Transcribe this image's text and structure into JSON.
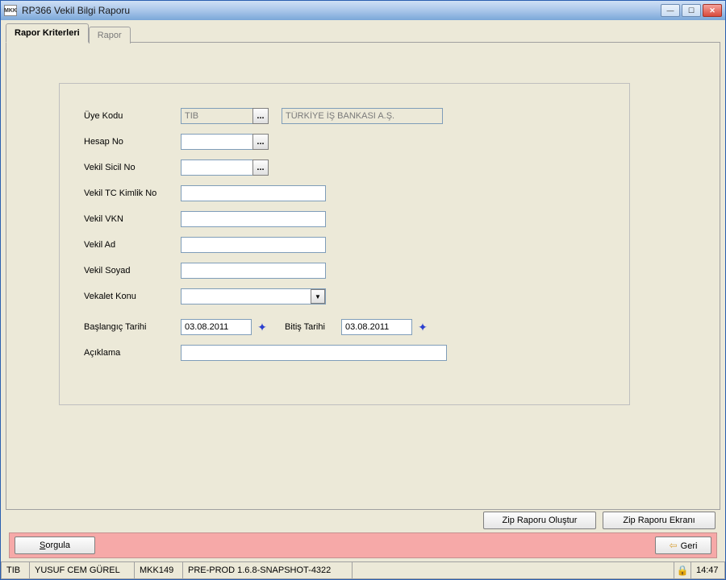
{
  "window": {
    "title": "RP366 Vekil Bilgi Raporu",
    "app_icon_text": "MKK"
  },
  "tabs": {
    "criteria": "Rapor Kriterleri",
    "report": "Rapor"
  },
  "labels": {
    "uye_kodu": "Üye Kodu",
    "hesap_no": "Hesap No",
    "vekil_sicil_no": "Vekil Sicil No",
    "vekil_tc": "Vekil TC Kimlik No",
    "vekil_vkn": "Vekil VKN",
    "vekil_ad": "Vekil Ad",
    "vekil_soyad": "Vekil Soyad",
    "vekalet_konu": "Vekalet Konu",
    "baslangic": "Başlangıç Tarihi",
    "bitis": "Bitiş Tarihi",
    "aciklama": "Açıklama"
  },
  "values": {
    "uye_kodu": "TIB",
    "uye_adi": "TÜRKİYE İŞ BANKASI A.Ş.",
    "hesap_no": "",
    "vekil_sicil_no": "",
    "vekil_tc": "",
    "vekil_vkn": "",
    "vekil_ad": "",
    "vekil_soyad": "",
    "vekalet_konu": "",
    "baslangic": "03.08.2011",
    "bitis": "03.08.2011",
    "aciklama": ""
  },
  "buttons": {
    "zip_create": "Zip Raporu Oluştur",
    "zip_screen": "Zip Raporu Ekranı",
    "sorgula": "Sorgula",
    "geri": "Geri"
  },
  "status": {
    "code": "TIB",
    "user": "YUSUF CEM GÜREL",
    "terminal": "MKK149",
    "version": "PRE-PROD 1.6.8-SNAPSHOT-4322",
    "clock": "14:47"
  },
  "icons": {
    "ellipsis": "...",
    "dropdown": "▼",
    "calendar": "✦",
    "lock": "🔒",
    "arrow_left": "⇦",
    "min": "—",
    "max": "☐",
    "close": "✕"
  }
}
